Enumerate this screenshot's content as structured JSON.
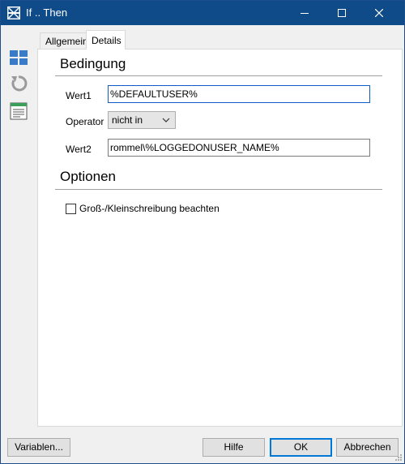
{
  "window": {
    "title": "If .. Then"
  },
  "titlebar_buttons": {
    "minimize": "minimize-icon",
    "maximize": "maximize-icon",
    "close": "close-icon"
  },
  "sidebar": {
    "icons": [
      "layout-grid-icon",
      "undo-icon",
      "list-view-icon"
    ]
  },
  "tabs": [
    {
      "label": "Allgemein",
      "active": false
    },
    {
      "label": "Details",
      "active": true
    }
  ],
  "bedingung": {
    "title": "Bedingung",
    "wert1_label": "Wert1",
    "wert1_value": "%DEFAULTUSER%",
    "operator_label": "Operator",
    "operator_value": "nicht in",
    "wert2_label": "Wert2",
    "wert2_value": "rommel\\%LOGGEDONUSER_NAME%"
  },
  "optionen": {
    "title": "Optionen",
    "case_sensitive_label": "Groß-/Kleinschreibung beachten",
    "case_sensitive_checked": false
  },
  "footer": {
    "variables_label": "Variablen...",
    "help_label": "Hilfe",
    "ok_label": "OK",
    "cancel_label": "Abbrechen"
  },
  "colors": {
    "titlebar": "#0f4a89",
    "focus": "#0f5ac9",
    "default_button": "#0078d7"
  }
}
